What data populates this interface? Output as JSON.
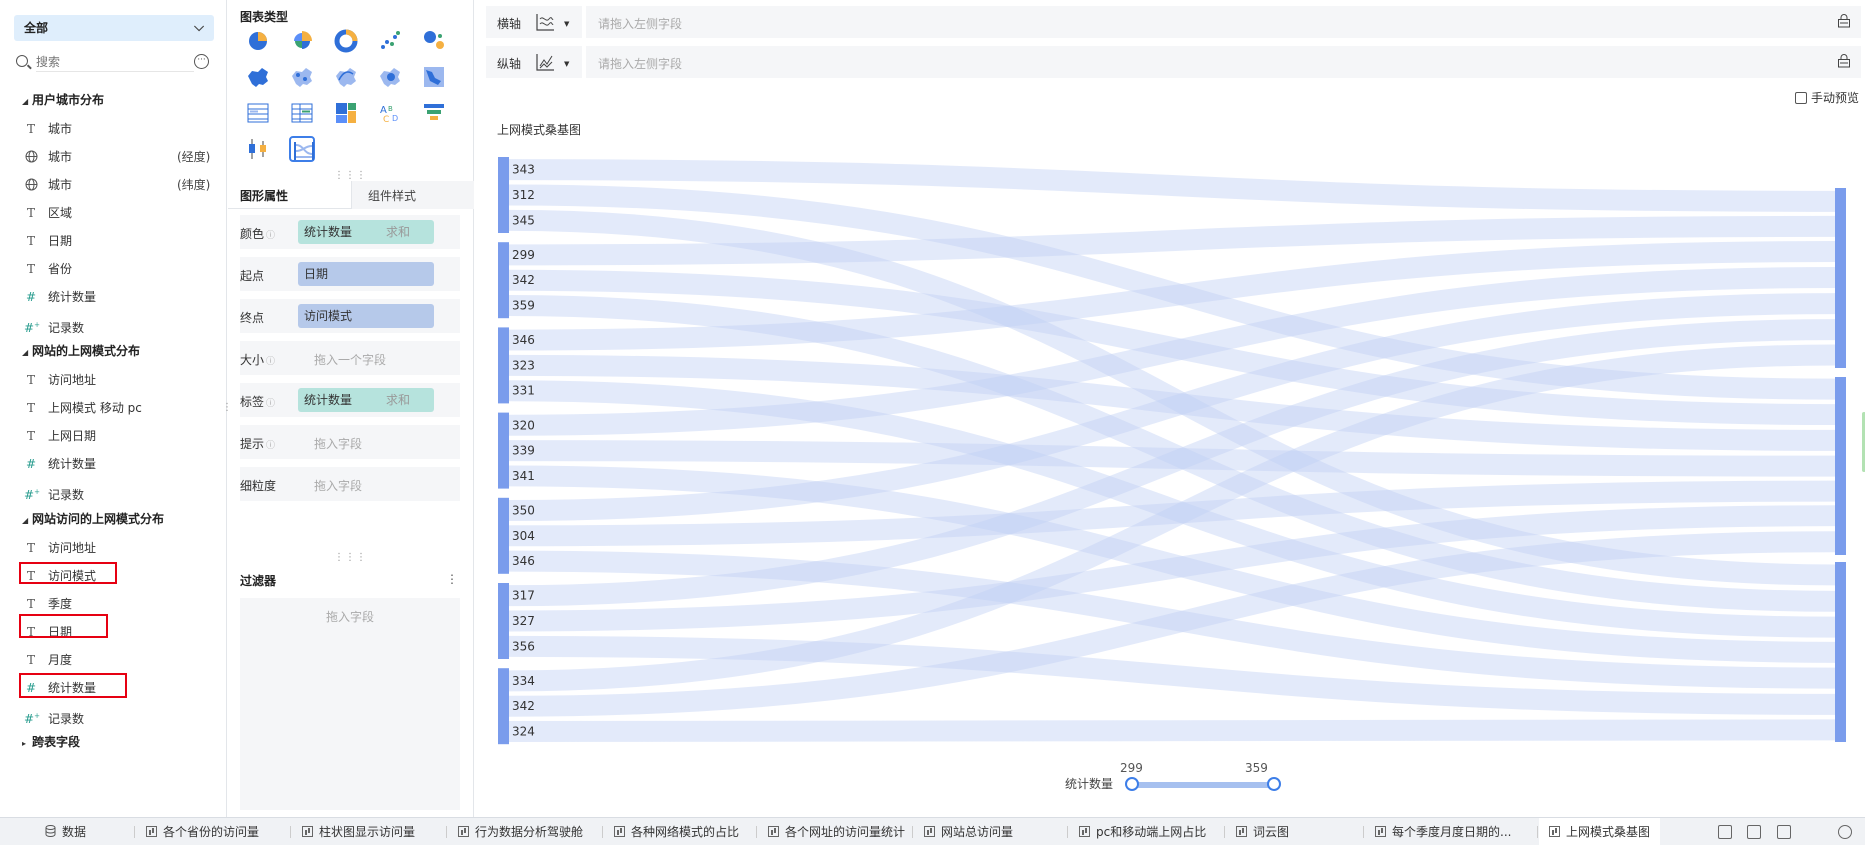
{
  "left": {
    "dataset": "全部",
    "search_placeholder": "搜索",
    "groups": [
      {
        "name": "用户城市分布",
        "fields": [
          {
            "icon": "text-field-icon",
            "label": "城市",
            "suffix": ""
          },
          {
            "icon": "globe-icon",
            "label": "城市",
            "suffix": "(经度)"
          },
          {
            "icon": "globe-icon",
            "label": "城市",
            "suffix": "(纬度)"
          },
          {
            "icon": "text-field-icon",
            "label": "区域",
            "suffix": ""
          },
          {
            "icon": "text-field-icon",
            "label": "日期",
            "suffix": ""
          },
          {
            "icon": "text-field-icon",
            "label": "省份",
            "suffix": ""
          },
          {
            "icon": "number-field-icon",
            "label": "统计数量",
            "suffix": ""
          },
          {
            "icon": "record-count-icon",
            "label": "记录数",
            "suffix": ""
          }
        ]
      },
      {
        "name": "网站的上网模式分布",
        "fields": [
          {
            "icon": "text-field-icon",
            "label": "访问地址",
            "suffix": ""
          },
          {
            "icon": "text-field-icon",
            "label": "上网模式 移动 pc",
            "suffix": ""
          },
          {
            "icon": "text-field-icon",
            "label": "上网日期",
            "suffix": ""
          },
          {
            "icon": "number-field-icon",
            "label": "统计数量",
            "suffix": ""
          },
          {
            "icon": "record-count-icon",
            "label": "记录数",
            "suffix": ""
          }
        ]
      },
      {
        "name": "网站访问的上网模式分布",
        "fields": [
          {
            "icon": "text-field-icon",
            "label": "访问地址",
            "suffix": ""
          },
          {
            "icon": "text-field-icon",
            "label": "访问模式",
            "suffix": ""
          },
          {
            "icon": "text-field-icon",
            "label": "季度",
            "suffix": ""
          },
          {
            "icon": "text-field-icon",
            "label": "日期",
            "suffix": ""
          },
          {
            "icon": "text-field-icon",
            "label": "月度",
            "suffix": ""
          },
          {
            "icon": "number-field-icon",
            "label": "统计数量",
            "suffix": ""
          },
          {
            "icon": "record-count-icon",
            "label": "记录数",
            "suffix": ""
          }
        ]
      },
      {
        "name": "跨表字段",
        "fields": []
      }
    ]
  },
  "mid": {
    "chart_type_title": "图表类型",
    "chart_types": [
      "pie-chart-icon",
      "rose-chart-icon",
      "donut-chart-icon",
      "scatter-chart-icon",
      "bubble-chart-icon",
      "china-map-icon",
      "dot-map-icon",
      "flow-map-icon",
      "heat-map-icon",
      "region-map-icon",
      "table-icon",
      "cross-table-icon",
      "treemap-icon",
      "word-cloud-icon",
      "funnel-chart-icon",
      "box-plot-icon",
      "sankey-chart-icon"
    ],
    "tab_props": "图形属性",
    "tab_style": "组件样式",
    "props": [
      {
        "label": "颜色",
        "info": true,
        "kind": "green",
        "value": "统计数量",
        "agg": "求和"
      },
      {
        "label": "起点",
        "info": false,
        "kind": "blue",
        "value": "日期",
        "agg": ""
      },
      {
        "label": "终点",
        "info": false,
        "kind": "blue",
        "value": "访问模式",
        "agg": ""
      },
      {
        "label": "大小",
        "info": true,
        "kind": "placeholder",
        "value": "拖入一个字段",
        "agg": ""
      },
      {
        "label": "标签",
        "info": true,
        "kind": "green",
        "value": "统计数量",
        "agg": "求和"
      },
      {
        "label": "提示",
        "info": true,
        "kind": "placeholder",
        "value": "拖入字段",
        "agg": ""
      },
      {
        "label": "细粒度",
        "info": false,
        "kind": "placeholder",
        "value": "拖入字段",
        "agg": ""
      }
    ],
    "filter_title": "过滤器",
    "filter_placeholder": "拖入字段"
  },
  "main": {
    "x_axis_label": "横轴",
    "y_axis_label": "纵轴",
    "axis_placeholder": "请拖入左侧字段",
    "manual_preview": "手动预览",
    "slider": {
      "label": "统计数量",
      "min": "299",
      "max": "359"
    }
  },
  "chart_data": {
    "type": "sankey",
    "title": "上网模式桑基图",
    "colors": {
      "node": "#7a9cec",
      "link": "#c2d1f4"
    },
    "source_groups": [
      [
        343,
        312,
        345
      ],
      [
        299,
        342,
        359
      ],
      [
        346,
        323,
        331
      ],
      [
        320,
        339,
        341
      ],
      [
        350,
        304,
        346
      ],
      [
        317,
        327,
        356
      ],
      [
        334,
        342,
        324
      ]
    ],
    "targets": 3,
    "flows_to_target": [
      [
        0,
        1,
        2
      ],
      [
        0,
        1,
        2
      ],
      [
        0,
        1,
        2
      ],
      [
        0,
        1,
        2
      ],
      [
        0,
        1,
        2
      ],
      [
        0,
        1,
        2
      ],
      [
        0,
        1,
        2
      ]
    ]
  },
  "bottom_tabs": [
    {
      "label": "数据",
      "icon": "database-icon",
      "active": false
    },
    {
      "label": "各个省份的访问量",
      "icon": "chart-icon",
      "active": false
    },
    {
      "label": "柱状图显示访问量",
      "icon": "chart-icon",
      "active": false
    },
    {
      "label": "行为数据分析驾驶舱",
      "icon": "dashboard-icon",
      "active": false
    },
    {
      "label": "各种网络模式的占比",
      "icon": "chart-icon",
      "active": false
    },
    {
      "label": "各个网址的访问量统计",
      "icon": "chart-icon",
      "active": false
    },
    {
      "label": "网站总访问量",
      "icon": "chart-icon",
      "active": false
    },
    {
      "label": "pc和移动端上网占比",
      "icon": "chart-icon",
      "active": false
    },
    {
      "label": "词云图",
      "icon": "chart-icon",
      "active": false
    },
    {
      "label": "每个季度月度日期的...",
      "icon": "chart-icon",
      "active": false
    },
    {
      "label": "上网模式桑基图",
      "icon": "chart-icon",
      "active": true
    }
  ]
}
